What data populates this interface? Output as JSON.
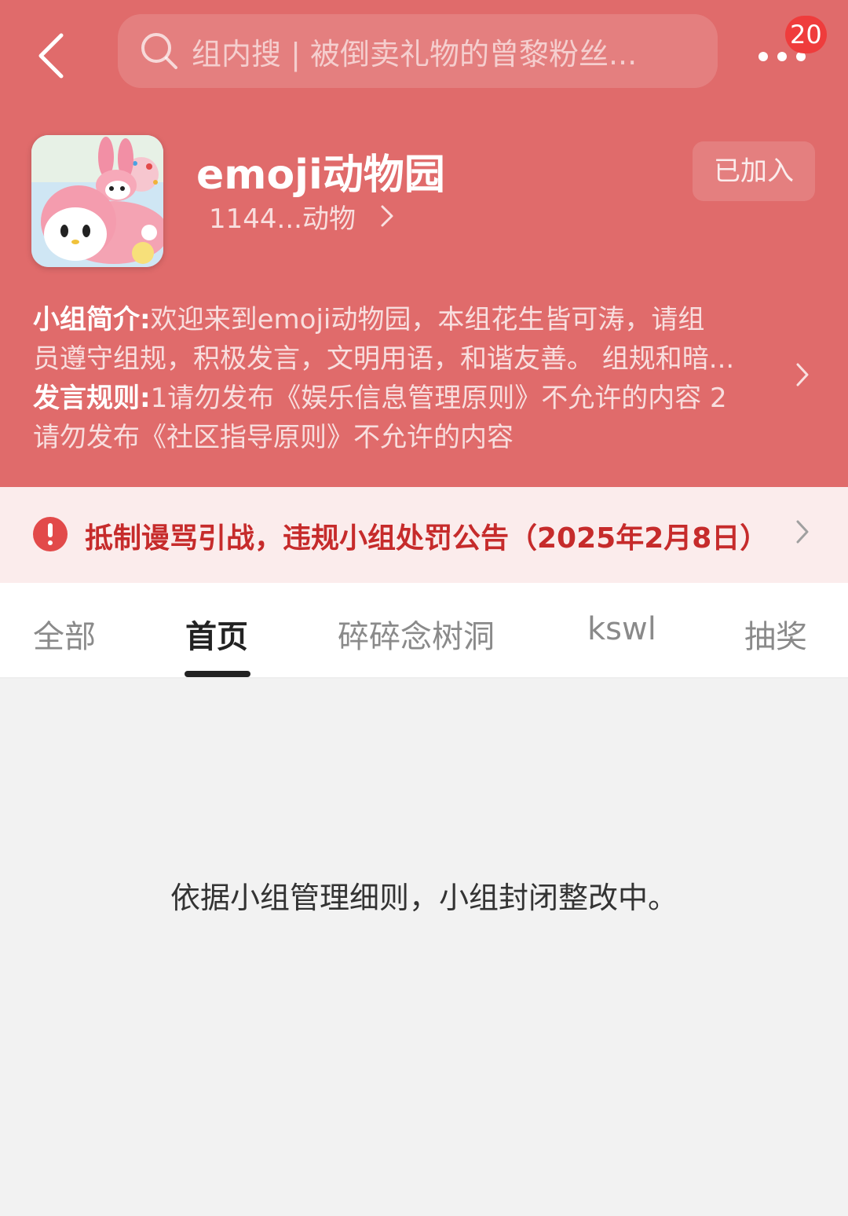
{
  "search": {
    "placeholder": "组内搜 | 被倒卖礼物的曾黎粉丝..."
  },
  "notifications": {
    "count": "20"
  },
  "group": {
    "name": "emoji动物园",
    "members": "1144...动物",
    "join_status": "已加入"
  },
  "description": {
    "intro_label": "小组简介:",
    "intro_line1": "欢迎来到emoji动物园，本组花生皆可涛，请组",
    "intro_line2": "员遵守组规，积极发言，文明用语，和谐友善。 组规和暗...",
    "rules_label": "发言规则:",
    "rules_line1": "1请勿发布《娱乐信息管理原则》不允许的内容 2",
    "rules_line2": "请勿发布《社区指导原则》不允许的内容"
  },
  "notice": {
    "text": "抵制谩骂引战，违规小组处罚公告（2025年2月8日）",
    "accent_color": "#c62b2b"
  },
  "tabs": [
    {
      "label": "全部",
      "active": false
    },
    {
      "label": "首页",
      "active": true
    },
    {
      "label": "碎碎念树洞",
      "active": false
    },
    {
      "label": "kswl",
      "active": false
    },
    {
      "label": "抽奖",
      "active": false
    }
  ],
  "content": {
    "empty_message": "依据小组管理细则，小组封闭整改中。"
  },
  "theme": {
    "header_bg": "#e06b6b",
    "notice_bg": "#fbecec",
    "page_bg": "#f2f2f2"
  }
}
